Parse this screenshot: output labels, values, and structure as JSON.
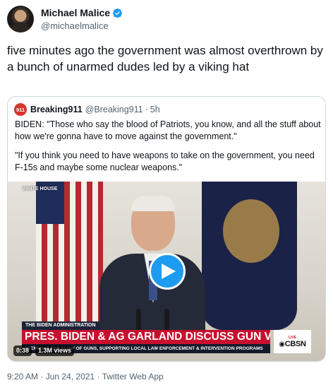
{
  "tweet": {
    "author_name": "Michael Malice",
    "author_handle": "@michaelmalice",
    "text": "five minutes ago the government was almost overthrown by a bunch of unarmed dudes led by a viking hat",
    "timestamp": "9:20 AM · Jun 24, 2021",
    "source": "Twitter Web App",
    "verified_icon": "verified-badge-icon"
  },
  "quote": {
    "avatar_text": "911",
    "author_name": "Breaking911",
    "author_handle": "@Breaking911",
    "time_ago": "5h",
    "paragraph_1": "BIDEN: \"Those who say the blood of Patriots, you know, and all the stuff about how we're gonna have to move against the government.\"",
    "paragraph_2": "\"If you think you need to have weapons to take on the government, you need F-15s and maybe some nuclear weapons.\""
  },
  "video": {
    "channel_label": "WHITE HOUSE",
    "lower_third_tag": "THE BIDEN ADMINISTRATION",
    "headline": "PRES. BIDEN & AG GARLAND DISCUSS GUN VIOLENCE",
    "subline": "STEMMING THE FLOW OF GUNS, SUPPORTING LOCAL LAW ENFORCEMENT & INTERVENTION PROGRAMS",
    "network_live": "LIVE",
    "network_logo": "CBSN",
    "duration": "0:38",
    "views": "1.3M views",
    "play_icon": "play-icon"
  },
  "colors": {
    "accent": "#1d9bf0",
    "text_primary": "#0f1419",
    "text_secondary": "#536471",
    "border": "#cfd9de",
    "news_red": "#c8102e"
  }
}
